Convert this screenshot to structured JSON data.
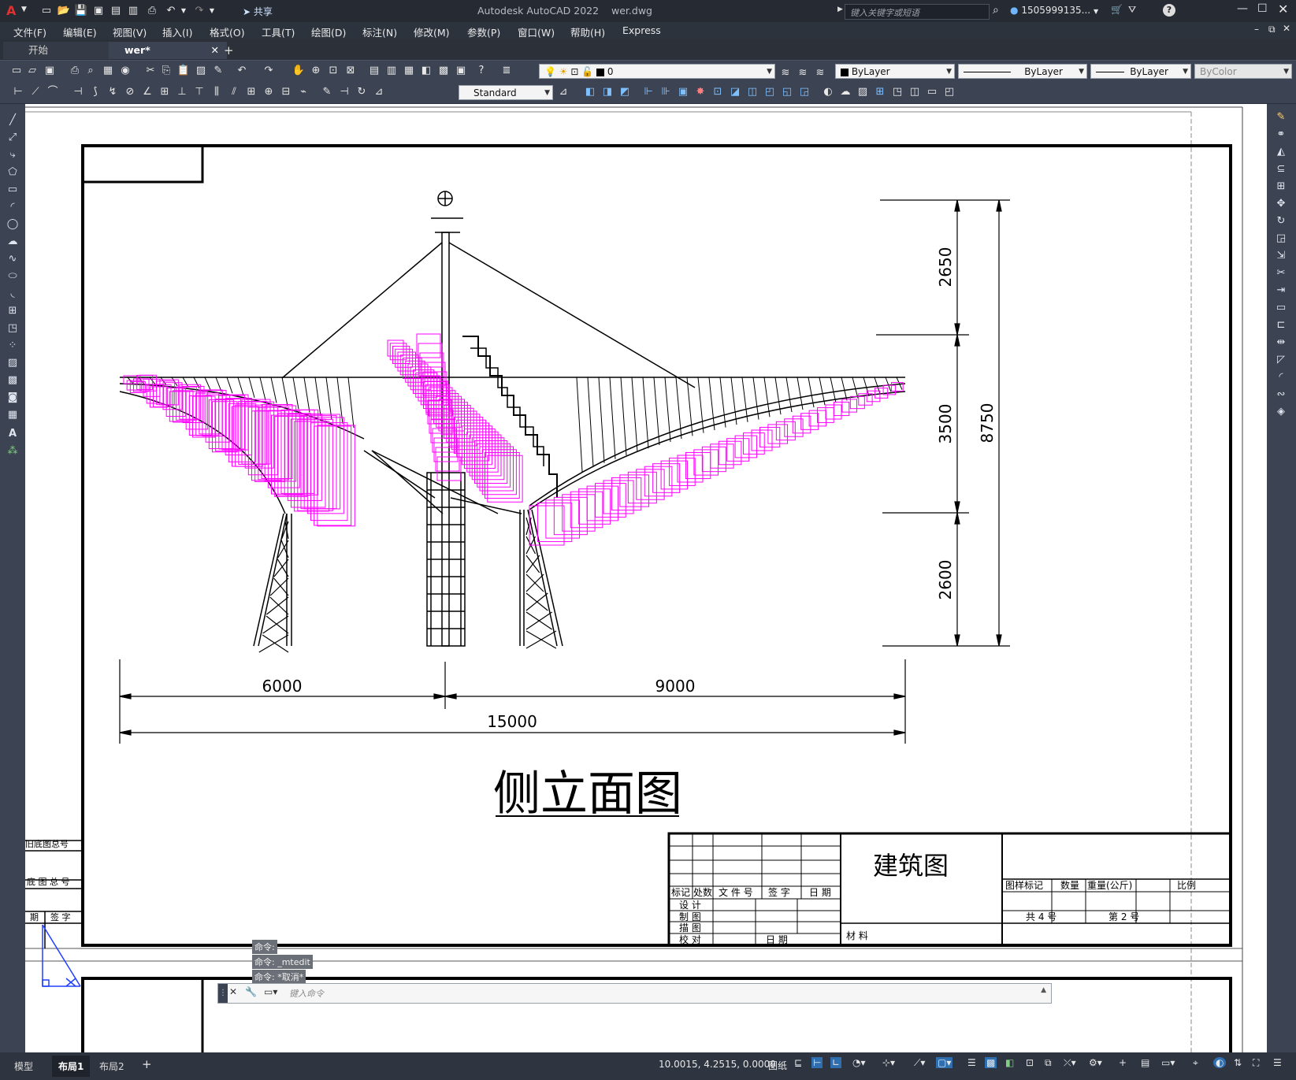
{
  "app": {
    "logo": "A",
    "title": "Autodesk AutoCAD 2022",
    "filename": "wer.dwg",
    "search_placeholder": "键入关键字或短语",
    "user": "1505999135...",
    "share_label": "共享"
  },
  "menu": [
    "文件(F)",
    "编辑(E)",
    "视图(V)",
    "插入(I)",
    "格式(O)",
    "工具(T)",
    "绘图(D)",
    "标注(N)",
    "修改(M)",
    "参数(P)",
    "窗口(W)",
    "帮助(H)",
    "Express"
  ],
  "tabs": [
    {
      "label": "开始"
    },
    {
      "label": "wer*"
    }
  ],
  "toolbar": {
    "layer_value": "0",
    "color_value": "ByLayer",
    "linetype_value": "ByLayer",
    "lineweight_value": "ByLayer",
    "plotstyle_value": "ByColor",
    "textstyle_value": "Standard"
  },
  "drawing": {
    "dims": {
      "h_left": "6000",
      "h_right": "9000",
      "h_total": "15000",
      "v_top": "2650",
      "v_mid": "3500",
      "v_bottom": "2600",
      "v_total": "8750"
    },
    "title": "侧立面图",
    "titleblock": {
      "drawing_type": "建筑图",
      "material": "材 料",
      "headers": [
        "标记",
        "处数",
        "文 件 号",
        "签 字",
        "日 期"
      ],
      "roles": [
        "设 计",
        "制 图",
        "描 图",
        "校 对"
      ],
      "date_label": "日 期",
      "right_headers": [
        "图样标记",
        "数量",
        "重量(公斤)",
        "比例"
      ],
      "total_sheets": "共 4 号",
      "sheet_no": "第 2 号"
    },
    "left_block": [
      "旧底图总号",
      "底 图 总 号",
      "期",
      "签 字"
    ]
  },
  "command": {
    "history": [
      "命令:",
      "命令: _mtedit",
      "命令: *取消*"
    ],
    "placeholder": "键入命令"
  },
  "layout_tabs": [
    "模型",
    "布局1",
    "布局2"
  ],
  "status": {
    "coords": "10.0015, 4.2515, 0.0000",
    "space": "图纸"
  }
}
